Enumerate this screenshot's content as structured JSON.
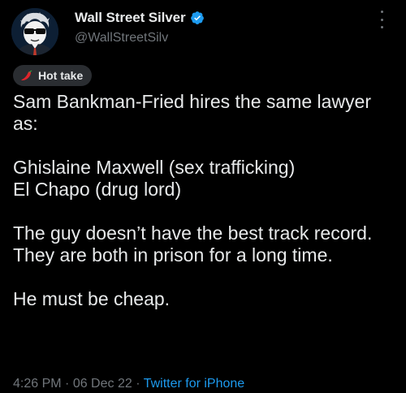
{
  "author": {
    "display_name": "Wall Street Silver",
    "handle": "@WallStreetSilv",
    "verified_icon": "verified-badge-icon",
    "avatar_icon": "wsb-mascot-avatar"
  },
  "menu": {
    "icon": "more-vertical-icon"
  },
  "tag": {
    "icon": "hot-pepper-icon",
    "label": "Hot take"
  },
  "tweet": {
    "text": "Sam Bankman-Fried hires the same lawyer as:\n\nGhislaine Maxwell (sex trafficking)\nEl Chapo (drug lord)\n\nThe guy doesn’t have the best track record. They are both in prison for a long time.\n\nHe must be cheap."
  },
  "meta": {
    "time": "4:26 PM",
    "separator": " · ",
    "date": "06 Dec 22",
    "source": "Twitter for iPhone"
  },
  "colors": {
    "background": "#000000",
    "text": "#e7e9ea",
    "muted": "#71767b",
    "accent": "#1d9bf0",
    "pill": "#2a2d31"
  }
}
